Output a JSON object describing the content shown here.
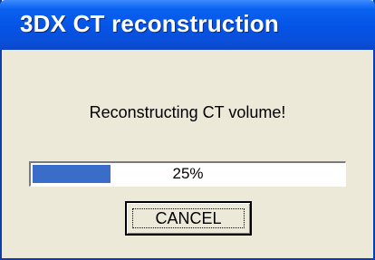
{
  "window": {
    "title": "3DX CT reconstruction"
  },
  "dialog": {
    "message": "Reconstructing CT volume!"
  },
  "progress": {
    "value": 0.25,
    "label": "25%"
  },
  "buttons": {
    "cancel_label": "CANCEL"
  },
  "colors": {
    "title_bar": "#0553e6",
    "progress_fill": "#3a6dc8",
    "dialog_background": "#ece9d8"
  }
}
